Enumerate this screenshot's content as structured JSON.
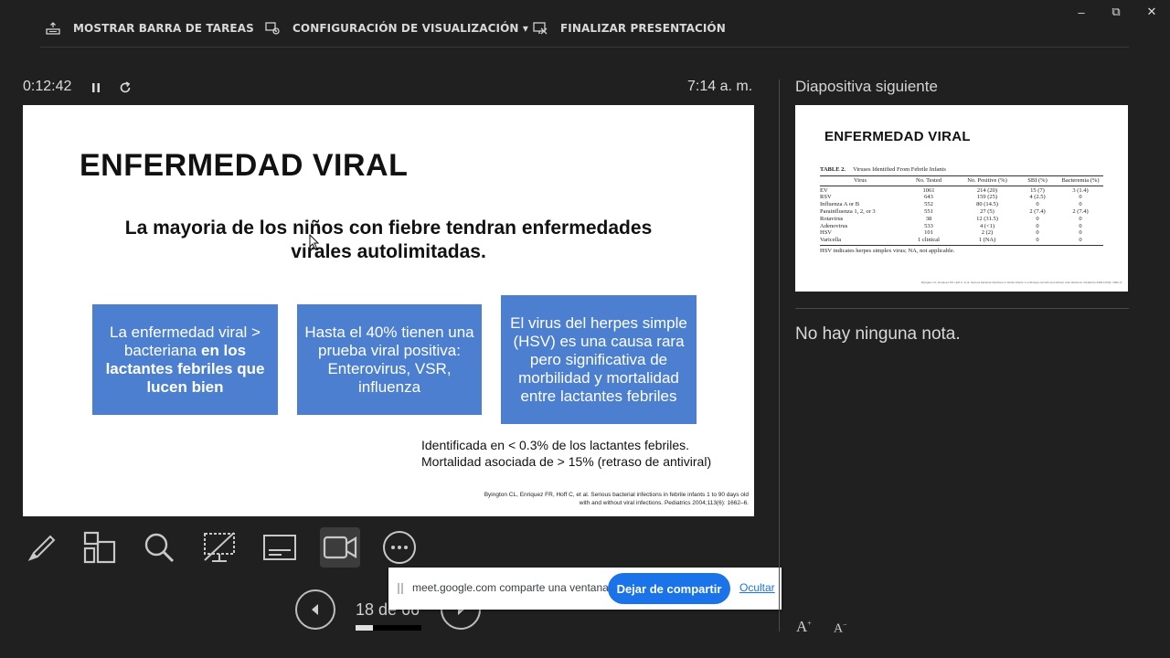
{
  "toolbar": {
    "taskbar_label": "MOSTRAR BARRA DE TAREAS",
    "display_settings_label": "CONFIGURACIÓN DE VISUALIZACIÓN",
    "display_settings_caret": "▾",
    "end_show_label": "FINALIZAR PRESENTACIÓN"
  },
  "window": {
    "minimize": "–",
    "restore": "⧉",
    "close": "✕"
  },
  "status": {
    "timer": "0:12:42",
    "clock": "7:14 a. m."
  },
  "slide": {
    "title": "ENFERMEDAD VIRAL",
    "subtitle_line1": "La mayoria de los niños con fiebre tendran enfermedades",
    "subtitle_line2": "virales autolimitadas.",
    "box1_plain": "La enfermedad viral > bacteriana ",
    "box1_bold": "en los lactantes febriles que lucen bien",
    "box2": "Hasta el 40% tienen una prueba viral positiva: Enterovirus, VSR, influenza",
    "box3": "El virus del herpes simple (HSV) es una causa rara pero significativa de morbilidad y mortalidad entre lactantes febriles",
    "note_line1": "Identificada en < 0.3% de los lactantes febriles.",
    "note_line2": "Mortalidad asociada de > 15% (retraso de antiviral)",
    "ref_line1": "Byington CL, Enriquez FR, Hoff C, et al. Serious bacterial infections in febrile infants 1 to 90 days old",
    "ref_line2": "with and without viral infections. Pediatrics 2004;113(6): 1662–6."
  },
  "navigation": {
    "page_counter": "18 de 66",
    "progress": 0.27
  },
  "share_bar": {
    "message": "meet.google.com comparte una ventana.",
    "stop_button": "Dejar de compartir",
    "hide_link": "Ocultar"
  },
  "next_slide": {
    "label": "Diapositiva siguiente",
    "title": "ENFERMEDAD VIRAL",
    "table_number": "TABLE 2.",
    "table_caption": "Viruses Identified From Febrile Infants",
    "columns": [
      "Virus",
      "No. Tested",
      "No. Positive (%)",
      "SBI (%)",
      "Bacteremia (%)"
    ],
    "rows": [
      [
        "EV",
        "1061",
        "214 (20)",
        "15 (7)",
        "3 (1.4)"
      ],
      [
        "RSV",
        "643",
        "159 (25)",
        "4 (2.5)",
        "0"
      ],
      [
        "Influenza A or B",
        "552",
        "80 (14.5)",
        "0",
        "0"
      ],
      [
        "Parainfluenza 1, 2, or 3",
        "551",
        "27 (5)",
        "2 (7.4)",
        "2 (7.4)"
      ],
      [
        "Rotavirus",
        "38",
        "12 (31.5)",
        "0",
        "0"
      ],
      [
        "Adenovirus",
        "533",
        "4 (<1)",
        "0",
        "0"
      ],
      [
        "HSV",
        "101",
        "2 (2)",
        "0",
        "0"
      ],
      [
        "Varicella",
        "1 clinical",
        "1 (NA)",
        "0",
        "0"
      ]
    ],
    "table_footnote": "HSV indicates herpes simplex virus; NA, not applicable.",
    "reference": "Byington CL, Enriquez FR, Hoff C, et al. Serious bacterial infections in febrile infants 1 to 90 days old with and without viral infections. Pediatrics 2004;113(6): 1662–6."
  },
  "notes": {
    "empty_text": "No hay ninguna nota."
  },
  "font_controls": {
    "increase": "A",
    "decrease": "A"
  },
  "icons": [
    "taskbar-icon",
    "display-settings-icon",
    "end-show-icon",
    "pause-icon",
    "restart-icon",
    "pen-icon",
    "see-all-slides-icon",
    "zoom-icon",
    "black-screen-icon",
    "subtitles-icon",
    "camera-icon",
    "more-options-icon",
    "prev-arrow-icon",
    "next-arrow-icon"
  ]
}
